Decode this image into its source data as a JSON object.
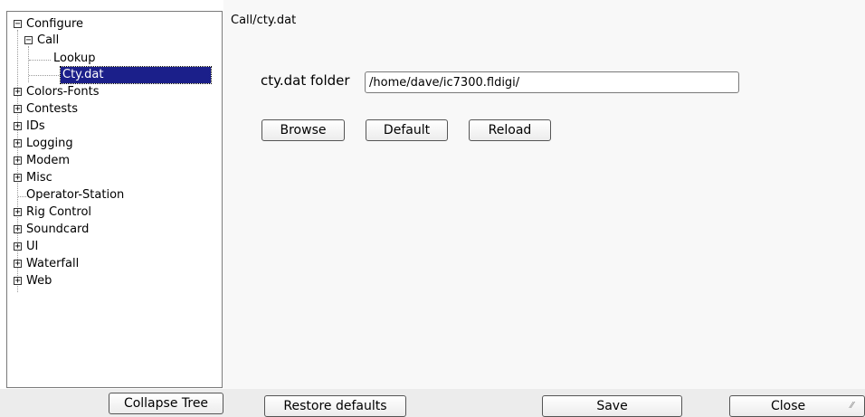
{
  "tree": {
    "root": {
      "label": "Configure",
      "toggle": "−"
    },
    "call": {
      "label": "Call",
      "toggle": "−"
    },
    "call_children": [
      "Lookup",
      "Cty.dat"
    ],
    "items": [
      {
        "label": "Colors-Fonts",
        "toggle": "+"
      },
      {
        "label": "Contests",
        "toggle": "+"
      },
      {
        "label": "IDs",
        "toggle": "+"
      },
      {
        "label": "Logging",
        "toggle": "+"
      },
      {
        "label": "Modem",
        "toggle": "+"
      },
      {
        "label": "Misc",
        "toggle": "+"
      },
      {
        "label": "Operator-Station",
        "toggle": ""
      },
      {
        "label": "Rig Control",
        "toggle": "+"
      },
      {
        "label": "Soundcard",
        "toggle": "+"
      },
      {
        "label": "UI",
        "toggle": "+"
      },
      {
        "label": "Waterfall",
        "toggle": "+"
      },
      {
        "label": "Web",
        "toggle": "+"
      }
    ]
  },
  "content": {
    "breadcrumb": "Call/cty.dat",
    "folder_label": "cty.dat folder",
    "folder_value": "/home/dave/ic7300.fldigi/",
    "browse_label": "Browse",
    "default_label": "Default",
    "reload_label": "Reload"
  },
  "footer": {
    "collapse_label": "Collapse Tree",
    "restore_label": "Restore defaults",
    "save_label": "Save",
    "close_label": "Close"
  }
}
